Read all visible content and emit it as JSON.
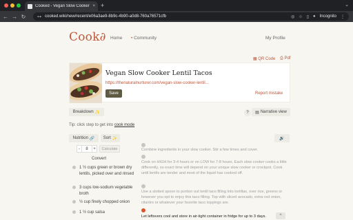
{
  "browser": {
    "tab_title": "Cooked - Vegan Slow Cooker",
    "tab_close": "×",
    "new_tab": "+",
    "tab_menu": "⌄",
    "url": "cooked.wiki/new/recent/e06a3ae9-8b9c-4b90-a0d8-760a76571cfb",
    "profile_label": "Incognito"
  },
  "header": {
    "logo": "Cook∂",
    "nav": [
      "Home",
      "Community"
    ],
    "community_bullet": "•",
    "profile": "My Profile"
  },
  "actions": {
    "qr": "QR Code",
    "pdf": "Pdf"
  },
  "recipe": {
    "title": "Vegan Slow Cooker Lentil Tacos",
    "source_url": "https://thenaturalnurturer.com/vegan-slow-cooker-lentil...",
    "save_label": "Save",
    "report_label": "Report mistake"
  },
  "controls": {
    "breakdown": "Breakdown",
    "help": "?",
    "narrative": "Narrative view",
    "tip_prefix": "Tip: click step to get into ",
    "tip_link": "cook mode",
    "nutrition": "Nutrition",
    "sort": "Sort",
    "servings": "8",
    "minus": "-",
    "plus": "+",
    "calculate": "Calculate",
    "convert": "Convert"
  },
  "ingredients": [
    "1 ½ cups green or brown dry lentils, picked over and rinsed",
    "3 cups low-sodium vegetable broth",
    "½ cup finely chopped onion",
    "1 ½ cup salsa"
  ],
  "steps": [
    "Combine ingredients in your slow cooker. Stir a few times and cover.",
    "Cook on HIGH for 3-4 hours or on LOW for 7-8 hours. Each slow cooker cooks a little differently, so exact time will depend on your unique slow cooker or crockpot. Cook until lentils are tender and most of the liquid has cooked off.",
    "Use a slotted spoon to portion out lentil taco filling into tortillas, over rice, greens or however you opt to enjoy this taco filling. Top with sliced avocado, extra red onion, cilantro or whatever your favorite taco toppings are.",
    "Let leftovers cool and store in air-tight container in fridge for up to 3 days."
  ],
  "scroll_up": "^",
  "colors": {
    "accent": "#c0563a",
    "save_button": "#5f5a44",
    "active_step": "#d9532f"
  }
}
